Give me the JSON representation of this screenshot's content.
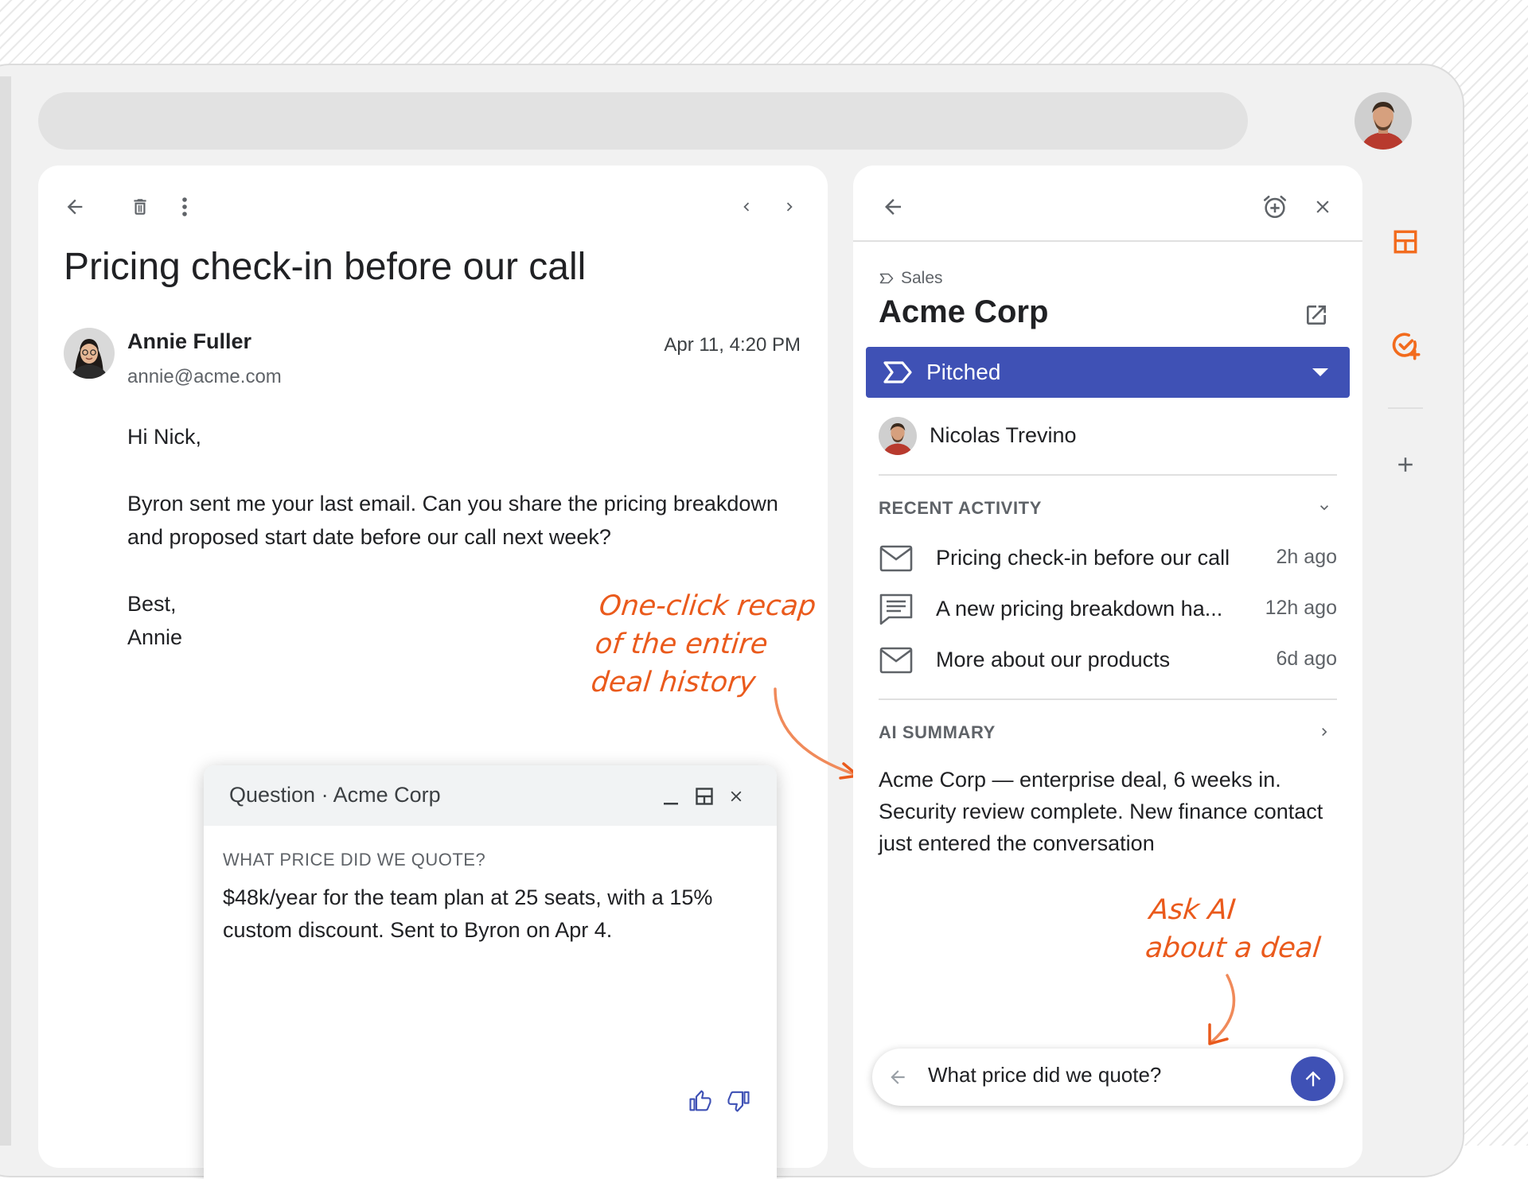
{
  "search": {
    "placeholder": ""
  },
  "email": {
    "subject": "Pricing check-in before our call",
    "sender_name": "Annie Fuller",
    "sender_email": "annie@acme.com",
    "date": "Apr 11, 4:20 PM",
    "greeting": "Hi Nick,",
    "body_line1": "Byron sent me your last email. Can you share the pricing breakdown",
    "body_line2": "and proposed start date before our call next week?",
    "signoff": "Best,",
    "signature": "Annie"
  },
  "annotations": {
    "recap_line1": "One-click recap",
    "recap_line2": "of the entire",
    "recap_line3": "deal history",
    "ask_line1": "Ask AI",
    "ask_line2": "about a deal",
    "color": "#ea5a1c"
  },
  "qa_window": {
    "title": "Question · Acme Corp",
    "question": "WHAT PRICE DID WE QUOTE?",
    "answer": "$48k/year for the team plan at 25 seats, with a 15% custom discount. Sent to Byron on Apr 4."
  },
  "deal": {
    "pipeline": "Sales",
    "name": "Acme Corp",
    "stage": "Pitched",
    "stage_color": "#3f51b5",
    "owner": "Nicolas Trevino",
    "recent_activity_label": "RECENT ACTIVITY",
    "activities": [
      {
        "icon": "mail-icon",
        "title": "Pricing check-in before our call",
        "time": "2h ago"
      },
      {
        "icon": "note-icon",
        "title": "A new pricing breakdown ha...",
        "time": "12h ago"
      },
      {
        "icon": "mail-icon",
        "title": "More about our products",
        "time": "6d ago"
      }
    ],
    "ai_summary_label": "AI SUMMARY",
    "ai_summary": "Acme Corp — enterprise deal, 6 weeks in. Security review complete. New finance contact just entered the conversation"
  },
  "ask": {
    "value": "What price did we quote?"
  },
  "rail": {
    "accent": "#f26b1d"
  }
}
